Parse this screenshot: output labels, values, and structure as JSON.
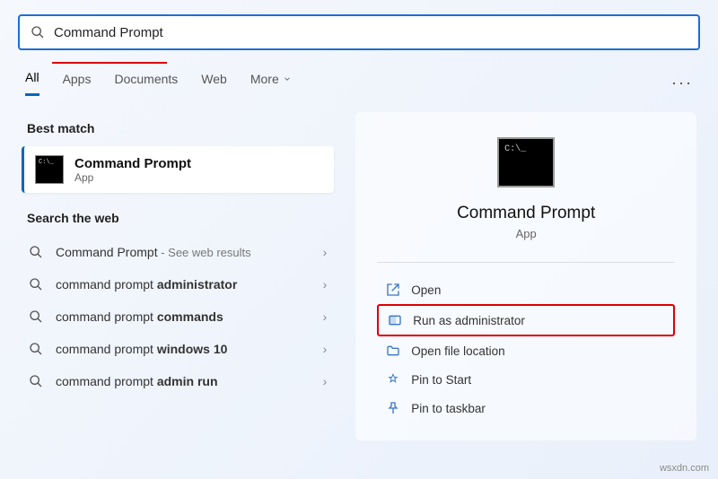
{
  "search": {
    "value": "Command Prompt"
  },
  "tabs": {
    "all": "All",
    "apps": "Apps",
    "documents": "Documents",
    "web": "Web",
    "more": "More"
  },
  "left": {
    "best_match_header": "Best match",
    "best_match": {
      "title": "Command Prompt",
      "subtitle": "App"
    },
    "search_web_header": "Search the web",
    "web": [
      {
        "prefix": "Command Prompt",
        "bold": "",
        "suffix": " - See web results"
      },
      {
        "prefix": "command prompt ",
        "bold": "administrator",
        "suffix": ""
      },
      {
        "prefix": "command prompt ",
        "bold": "commands",
        "suffix": ""
      },
      {
        "prefix": "command prompt ",
        "bold": "windows 10",
        "suffix": ""
      },
      {
        "prefix": "command prompt ",
        "bold": "admin run",
        "suffix": ""
      }
    ]
  },
  "right": {
    "title": "Command Prompt",
    "subtitle": "App",
    "actions": {
      "open": "Open",
      "run_admin": "Run as administrator",
      "open_location": "Open file location",
      "pin_start": "Pin to Start",
      "pin_taskbar": "Pin to taskbar"
    }
  },
  "watermark": "wsxdn.com"
}
